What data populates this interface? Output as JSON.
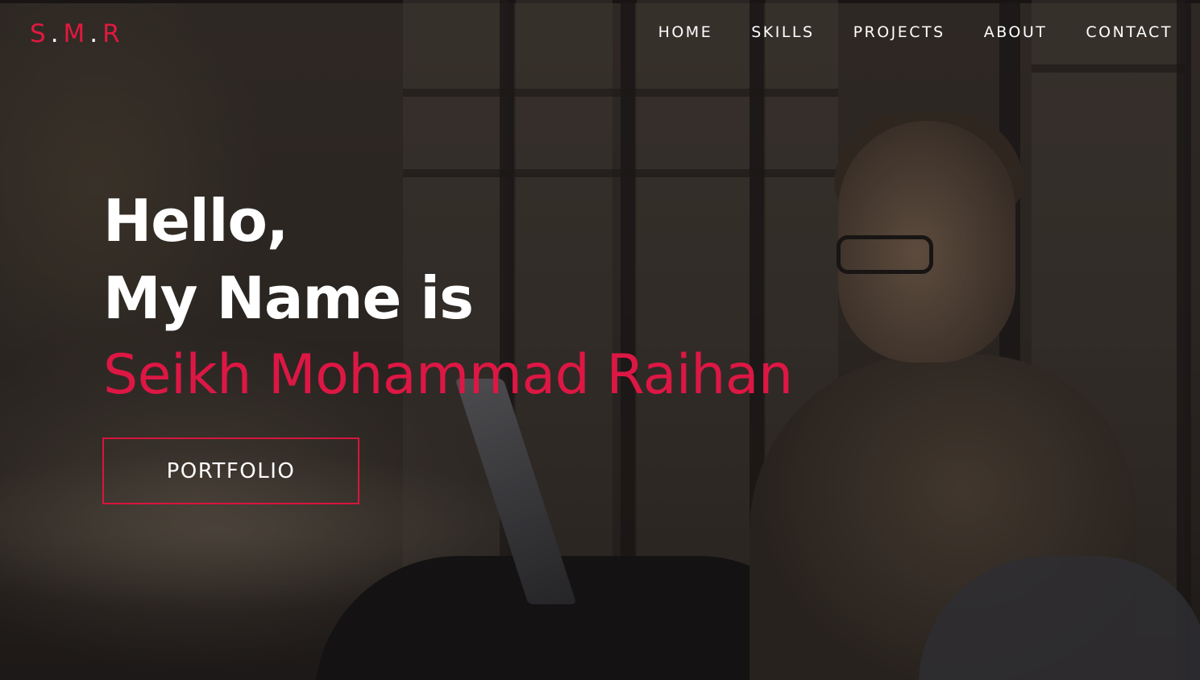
{
  "brand": {
    "letter_1": "S",
    "dot_1": ".",
    "letter_2": "M",
    "dot_2": ".",
    "letter_3": "R"
  },
  "nav": {
    "items": [
      {
        "label": "HOME"
      },
      {
        "label": "SKILLS"
      },
      {
        "label": "PROJECTS"
      },
      {
        "label": "ABOUT"
      },
      {
        "label": "CONTACT"
      }
    ]
  },
  "hero": {
    "line_1": "Hello,",
    "line_2": "My Name is",
    "name": "Seikh Mohammad Raihan",
    "button_label": "PORTFOLIO"
  },
  "colors": {
    "accent": "#dd1744",
    "text": "#ffffff",
    "background": "#2f2822"
  }
}
